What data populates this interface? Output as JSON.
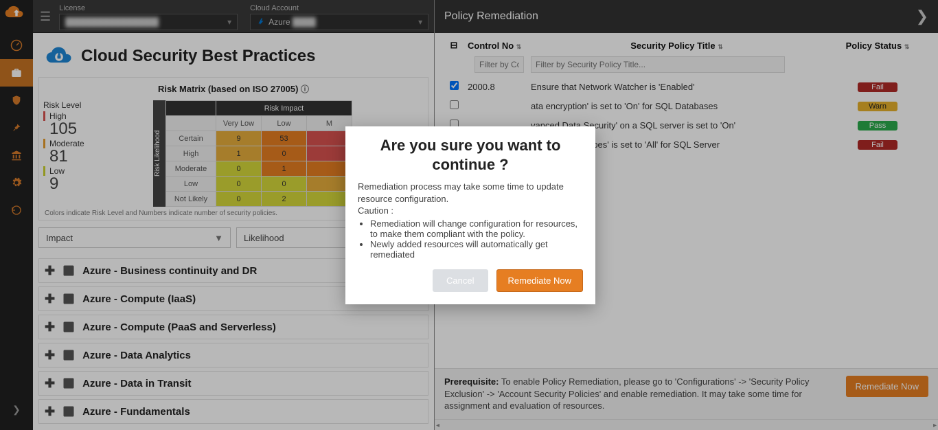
{
  "topbar": {
    "license_label": "License",
    "license_value": "████████████████",
    "cloud_label": "Cloud Account",
    "cloud_value": "Azure ████"
  },
  "page": {
    "title": "Cloud Security Best Practices"
  },
  "matrix": {
    "title": "Risk Matrix (based on ISO 27005)",
    "risk_level_label": "Risk Level",
    "high_label": "High",
    "high_value": "105",
    "moderate_label": "Moderate",
    "moderate_value": "81",
    "low_label": "Low",
    "low_value": "9",
    "impact_header": "Risk Impact",
    "likelihood_header": "Risk Likelihood",
    "cols": [
      "Very Low",
      "Low",
      "M"
    ],
    "rows": [
      "Certain",
      "High",
      "Moderate",
      "Low",
      "Not Likely"
    ],
    "cells": {
      "certain": [
        "9",
        "53",
        ""
      ],
      "high": [
        "1",
        "0",
        ""
      ],
      "moderate": [
        "0",
        "1",
        ""
      ],
      "low": [
        "0",
        "0",
        ""
      ],
      "notlikely": [
        "0",
        "2",
        ""
      ]
    },
    "legend": "Colors indicate Risk Level and Numbers indicate number of security policies."
  },
  "filters": {
    "impact": "Impact",
    "likelihood": "Likelihood"
  },
  "accordion": [
    "Azure - Business continuity and DR",
    "Azure - Compute (IaaS)",
    "Azure - Compute (PaaS and Serverless)",
    "Azure - Data Analytics",
    "Azure - Data in Transit",
    "Azure - Fundamentals"
  ],
  "right": {
    "title": "Policy Remediation",
    "col_control": "Control No",
    "col_policy": "Security Policy Title",
    "col_status": "Policy Status",
    "filter_control_ph": "Filter by Co",
    "filter_title_ph": "Filter by Security Policy Title...",
    "rows": [
      {
        "checked": true,
        "control": "2000.8",
        "title": "Ensure that Network Watcher is 'Enabled'",
        "status": "Fail",
        "cls": "b-fail"
      },
      {
        "checked": false,
        "control": "",
        "title": "ata encryption' is set to 'On' for SQL Databases",
        "status": "Warn",
        "cls": "b-warn"
      },
      {
        "checked": false,
        "control": "",
        "title": "vanced Data Security' on a SQL server is set to 'On'",
        "status": "Pass",
        "cls": "b-pass"
      },
      {
        "checked": false,
        "control": "",
        "title": "eat Detection types' is set to 'All' for SQL Server",
        "status": "Fail",
        "cls": "b-fail"
      }
    ],
    "prereq_label": "Prerequisite:",
    "prereq_text": "To enable Policy Remediation, please go to 'Configurations' -> 'Security Policy Exclusion' -> 'Account Security Policies' and enable remediation. It may take some time for assignment and evaluation of resources.",
    "remediate_btn": "Remediate Now"
  },
  "modal": {
    "title": "Are you sure you want to continue ?",
    "line1": "Remediation process may take some time to update resource configuration.",
    "caution": "Caution :",
    "bullet1": "Remediation will change configuration for resources, to make them compliant with the policy.",
    "bullet2": "Newly added resources will automatically get remediated",
    "cancel": "Cancel",
    "confirm": "Remediate Now"
  }
}
